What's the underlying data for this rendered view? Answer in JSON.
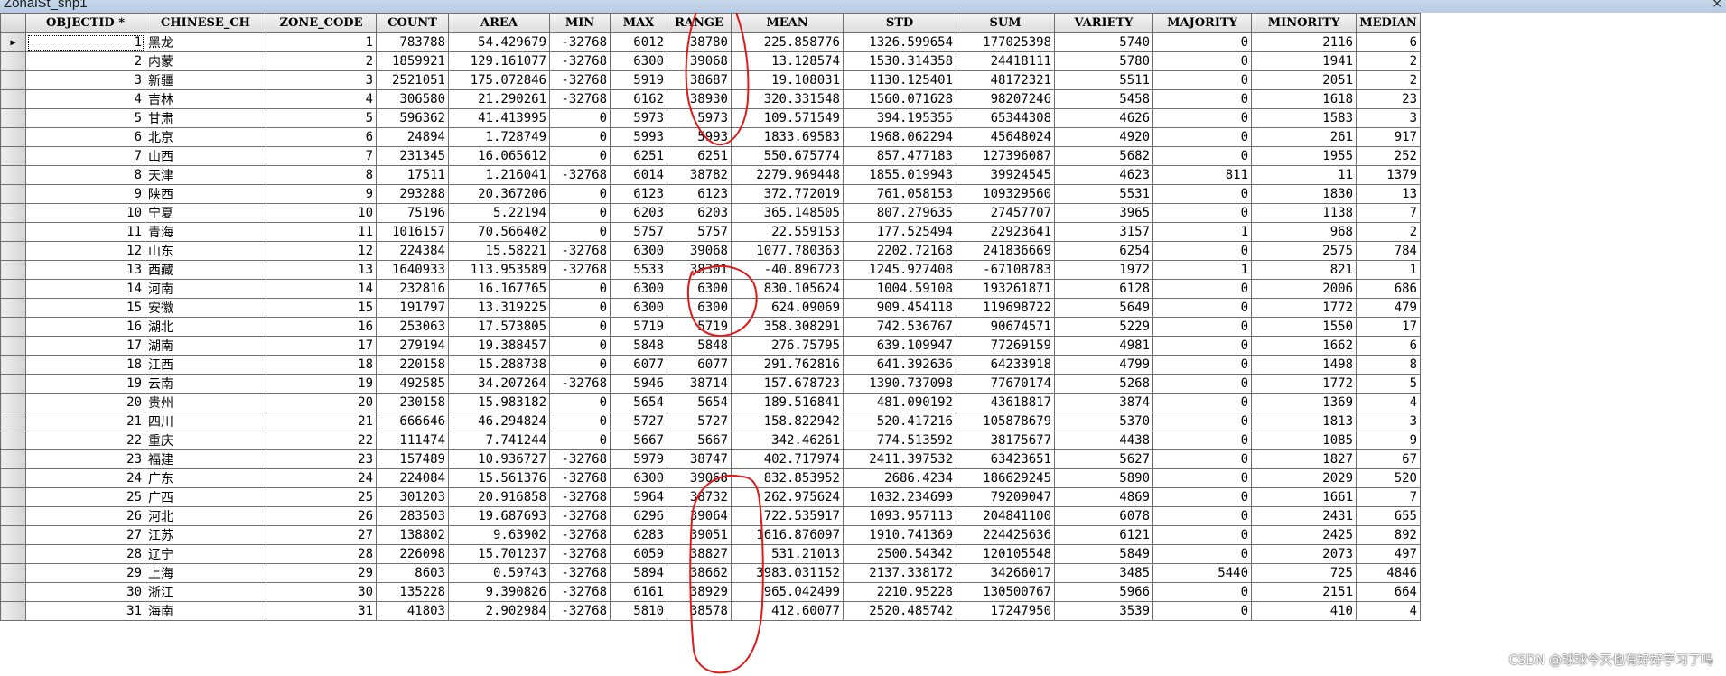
{
  "window": {
    "title": "ZonalSt_shp1",
    "close_glyph": "×"
  },
  "grid": {
    "columns": [
      "OBJECTID *",
      "CHINESE_CH",
      "ZONE_CODE",
      "COUNT",
      "AREA",
      "MIN",
      "MAX",
      "RANGE",
      "MEAN",
      "STD",
      "SUM",
      "VARIETY",
      "MAJORITY",
      "MINORITY",
      "MEDIAN"
    ],
    "current_row_marker": "▶",
    "rows": [
      [
        "1",
        "黑龙",
        "1",
        "783788",
        "54.429679",
        "-32768",
        "6012",
        "38780",
        "225.858776",
        "1326.599654",
        "177025398",
        "5740",
        "0",
        "2116",
        "6"
      ],
      [
        "2",
        "内蒙",
        "2",
        "1859921",
        "129.161077",
        "-32768",
        "6300",
        "39068",
        "13.128574",
        "1530.314358",
        "24418111",
        "5780",
        "0",
        "1941",
        "2"
      ],
      [
        "3",
        "新疆",
        "3",
        "2521051",
        "175.072846",
        "-32768",
        "5919",
        "38687",
        "19.108031",
        "1130.125401",
        "48172321",
        "5511",
        "0",
        "2051",
        "2"
      ],
      [
        "4",
        "吉林",
        "4",
        "306580",
        "21.290261",
        "-32768",
        "6162",
        "38930",
        "320.331548",
        "1560.071628",
        "98207246",
        "5458",
        "0",
        "1618",
        "23"
      ],
      [
        "5",
        "甘肃",
        "5",
        "596362",
        "41.413995",
        "0",
        "5973",
        "5973",
        "109.571549",
        "394.195355",
        "65344308",
        "4626",
        "0",
        "1583",
        "3"
      ],
      [
        "6",
        "北京",
        "6",
        "24894",
        "1.728749",
        "0",
        "5993",
        "5993",
        "1833.69583",
        "1968.062294",
        "45648024",
        "4920",
        "0",
        "261",
        "917"
      ],
      [
        "7",
        "山西",
        "7",
        "231345",
        "16.065612",
        "0",
        "6251",
        "6251",
        "550.675774",
        "857.477183",
        "127396087",
        "5682",
        "0",
        "1955",
        "252"
      ],
      [
        "8",
        "天津",
        "8",
        "17511",
        "1.216041",
        "-32768",
        "6014",
        "38782",
        "2279.969448",
        "1855.019943",
        "39924545",
        "4623",
        "811",
        "11",
        "1379"
      ],
      [
        "9",
        "陕西",
        "9",
        "293288",
        "20.367206",
        "0",
        "6123",
        "6123",
        "372.772019",
        "761.058153",
        "109329560",
        "5531",
        "0",
        "1830",
        "13"
      ],
      [
        "10",
        "宁夏",
        "10",
        "75196",
        "5.22194",
        "0",
        "6203",
        "6203",
        "365.148505",
        "807.279635",
        "27457707",
        "3965",
        "0",
        "1138",
        "7"
      ],
      [
        "11",
        "青海",
        "11",
        "1016157",
        "70.566402",
        "0",
        "5757",
        "5757",
        "22.559153",
        "177.525494",
        "22923641",
        "3157",
        "1",
        "968",
        "2"
      ],
      [
        "12",
        "山东",
        "12",
        "224384",
        "15.58221",
        "-32768",
        "6300",
        "39068",
        "1077.780363",
        "2202.72168",
        "241836669",
        "6254",
        "0",
        "2575",
        "784"
      ],
      [
        "13",
        "西藏",
        "13",
        "1640933",
        "113.953589",
        "-32768",
        "5533",
        "38301",
        "-40.896723",
        "1245.927408",
        "-67108783",
        "1972",
        "1",
        "821",
        "1"
      ],
      [
        "14",
        "河南",
        "14",
        "232816",
        "16.167765",
        "0",
        "6300",
        "6300",
        "830.105624",
        "1004.59108",
        "193261871",
        "6128",
        "0",
        "2006",
        "686"
      ],
      [
        "15",
        "安徽",
        "15",
        "191797",
        "13.319225",
        "0",
        "6300",
        "6300",
        "624.09069",
        "909.454118",
        "119698722",
        "5649",
        "0",
        "1772",
        "479"
      ],
      [
        "16",
        "湖北",
        "16",
        "253063",
        "17.573805",
        "0",
        "5719",
        "5719",
        "358.308291",
        "742.536767",
        "90674571",
        "5229",
        "0",
        "1550",
        "17"
      ],
      [
        "17",
        "湖南",
        "17",
        "279194",
        "19.388457",
        "0",
        "5848",
        "5848",
        "276.75795",
        "639.109947",
        "77269159",
        "4981",
        "0",
        "1662",
        "6"
      ],
      [
        "18",
        "江西",
        "18",
        "220158",
        "15.288738",
        "0",
        "6077",
        "6077",
        "291.762816",
        "641.392636",
        "64233918",
        "4799",
        "0",
        "1498",
        "8"
      ],
      [
        "19",
        "云南",
        "19",
        "492585",
        "34.207264",
        "-32768",
        "5946",
        "38714",
        "157.678723",
        "1390.737098",
        "77670174",
        "5268",
        "0",
        "1772",
        "5"
      ],
      [
        "20",
        "贵州",
        "20",
        "230158",
        "15.983182",
        "0",
        "5654",
        "5654",
        "189.516841",
        "481.090192",
        "43618817",
        "3874",
        "0",
        "1369",
        "4"
      ],
      [
        "21",
        "四川",
        "21",
        "666646",
        "46.294824",
        "0",
        "5727",
        "5727",
        "158.822942",
        "520.417216",
        "105878679",
        "5370",
        "0",
        "1813",
        "3"
      ],
      [
        "22",
        "重庆",
        "22",
        "111474",
        "7.741244",
        "0",
        "5667",
        "5667",
        "342.46261",
        "774.513592",
        "38175677",
        "4438",
        "0",
        "1085",
        "9"
      ],
      [
        "23",
        "福建",
        "23",
        "157489",
        "10.936727",
        "-32768",
        "5979",
        "38747",
        "402.717974",
        "2411.397532",
        "63423651",
        "5627",
        "0",
        "1827",
        "67"
      ],
      [
        "24",
        "广东",
        "24",
        "224084",
        "15.561376",
        "-32768",
        "6300",
        "39068",
        "832.853952",
        "2686.4234",
        "186629245",
        "5890",
        "0",
        "2029",
        "520"
      ],
      [
        "25",
        "广西",
        "25",
        "301203",
        "20.916858",
        "-32768",
        "5964",
        "38732",
        "262.975624",
        "1032.234699",
        "79209047",
        "4869",
        "0",
        "1661",
        "7"
      ],
      [
        "26",
        "河北",
        "26",
        "283503",
        "19.687693",
        "-32768",
        "6296",
        "39064",
        "722.535917",
        "1093.957113",
        "204841100",
        "6078",
        "0",
        "2431",
        "655"
      ],
      [
        "27",
        "江苏",
        "27",
        "138802",
        "9.63902",
        "-32768",
        "6283",
        "39051",
        "1616.876097",
        "1910.741369",
        "224425636",
        "6121",
        "0",
        "2425",
        "892"
      ],
      [
        "28",
        "辽宁",
        "28",
        "226098",
        "15.701237",
        "-32768",
        "6059",
        "38827",
        "531.21013",
        "2500.54342",
        "120105548",
        "5849",
        "0",
        "2073",
        "497"
      ],
      [
        "29",
        "上海",
        "29",
        "8603",
        "0.59743",
        "-32768",
        "5894",
        "38662",
        "3983.031152",
        "2137.338172",
        "34266017",
        "3485",
        "5440",
        "725",
        "4846"
      ],
      [
        "30",
        "浙江",
        "30",
        "135228",
        "9.390826",
        "-32768",
        "6161",
        "38929",
        "965.042499",
        "2210.95228",
        "130500767",
        "5966",
        "0",
        "2151",
        "664"
      ],
      [
        "31",
        "海南",
        "31",
        "41803",
        "2.902984",
        "-32768",
        "5810",
        "38578",
        "412.60077",
        "2520.485742",
        "17247950",
        "3539",
        "0",
        "410",
        "4"
      ]
    ]
  },
  "watermark": "CSDN @球球今天也有好好学习了吗",
  "annotation_color": "#e01a1a"
}
